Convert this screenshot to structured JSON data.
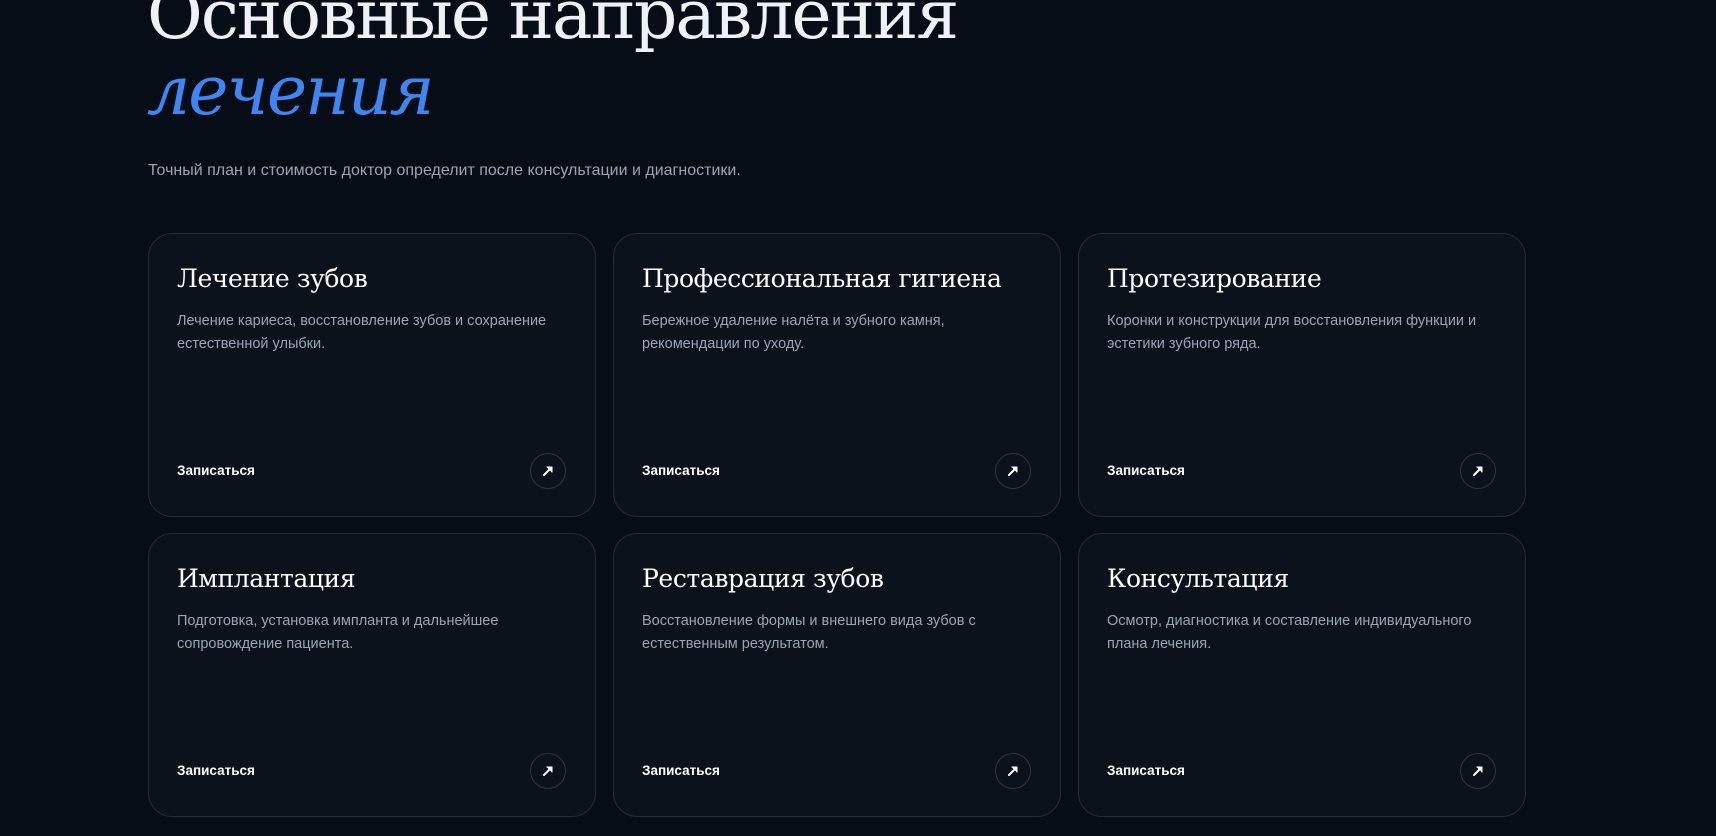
{
  "section": {
    "title": "Основные направления",
    "title_accent": "лечения",
    "subtitle": "Точный план и стоимость доктор определит после консультации и диагностики."
  },
  "cards": [
    {
      "title": "Лечение зубов",
      "description": "Лечение кариеса, восстановление зубов и сохранение естественной улыбки.",
      "link_label": "Записаться",
      "icon": "arrow-up-right-icon"
    },
    {
      "title": "Профессиональная гигиена",
      "description": "Бережное удаление налёта и зубного камня, рекомендации по уходу.",
      "link_label": "Записаться",
      "icon": "arrow-up-right-icon"
    },
    {
      "title": "Протезирование",
      "description": "Коронки и конструкции для восстановления функции и эстетики зубного ряда.",
      "link_label": "Записаться",
      "icon": "arrow-up-right-icon"
    },
    {
      "title": "Имплантация",
      "description": "Подготовка, установка импланта и дальнейшее сопровождение пациента.",
      "link_label": "Записаться",
      "icon": "arrow-up-right-icon"
    },
    {
      "title": "Реставрация зубов",
      "description": "Восстановление формы и внешнего вида зубов с естественным результатом.",
      "link_label": "Записаться",
      "icon": "arrow-up-right-icon"
    },
    {
      "title": "Консультация",
      "description": "Осмотр, диагностика и составление индивидуального плана лечения.",
      "link_label": "Записаться",
      "icon": "arrow-up-right-icon"
    }
  ],
  "colors": {
    "background": "#070d16",
    "card_background": "#0b121c",
    "accent": "#3f86f2",
    "muted_text": "#9aa4b2"
  }
}
